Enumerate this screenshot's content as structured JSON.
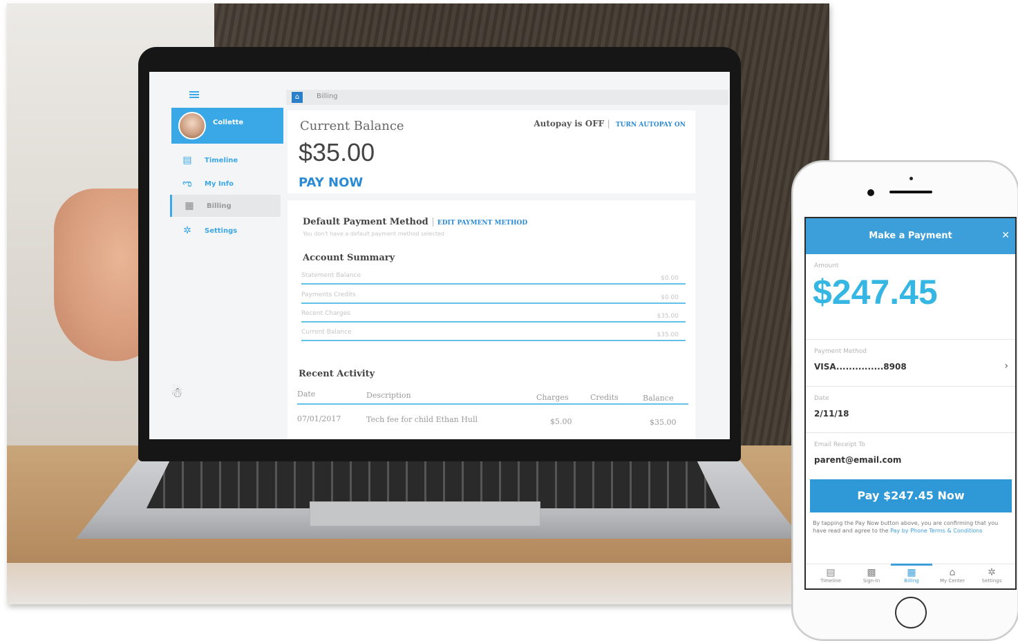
{
  "laptop": {
    "sidebar": {
      "user_name": "Collette",
      "items": [
        {
          "label": "Timeline",
          "icon": "timeline-icon"
        },
        {
          "label": "My Info",
          "icon": "my-info-icon"
        },
        {
          "label": "Billing",
          "icon": "billing-icon"
        },
        {
          "label": "Settings",
          "icon": "gear-icon"
        }
      ],
      "active_item": "Billing"
    },
    "breadcrumb": "Billing",
    "balance": {
      "label": "Current Balance",
      "amount": "$35.00",
      "pay_now": "PAY NOW",
      "autopay_status": "Autopay is OFF",
      "autopay_link": "TURN AUTOPAY ON"
    },
    "payment_method": {
      "title": "Default Payment Method",
      "edit_link": "EDIT PAYMENT METHOD",
      "note": "You don't have a default payment method selected"
    },
    "account_summary": {
      "title": "Account Summary",
      "rows": [
        {
          "label": "Statement Balance",
          "value": "$0.00"
        },
        {
          "label": "Payments Credits",
          "value": "$0.00"
        },
        {
          "label": "Recent Charges",
          "value": "$35.00"
        },
        {
          "label": "Current Balance",
          "value": "$35.00"
        }
      ]
    },
    "recent_activity": {
      "title": "Recent Activity",
      "columns": [
        "Date",
        "Description",
        "Charges",
        "Credits",
        "Balance"
      ],
      "rows": [
        {
          "date": "07/01/2017",
          "description": "Tech fee for child Ethan Hull",
          "charges": "$5.00",
          "credits": "",
          "balance": "$35.00"
        }
      ]
    }
  },
  "phone": {
    "title": "Make a Payment",
    "amount_label": "Amount",
    "amount": "$247.45",
    "payment_method_label": "Payment Method",
    "payment_method": "VISA...............8908",
    "date_label": "Date",
    "date": "2/11/18",
    "email_label": "Email Receipt To",
    "email": "parent@email.com",
    "pay_button": "Pay $247.45 Now",
    "terms_text": "By tapping the Pay Now button above, you are confirming that you have read and agree to the",
    "terms_link": "Pay by Phone Terms & Conditions",
    "tabs": [
      {
        "label": "Timeline",
        "icon": "timeline-icon"
      },
      {
        "label": "Sign-In",
        "icon": "qr-code-icon"
      },
      {
        "label": "Billing",
        "icon": "billing-icon"
      },
      {
        "label": "My Center",
        "icon": "building-icon"
      },
      {
        "label": "Settings",
        "icon": "gear-icon"
      }
    ],
    "active_tab": "Billing"
  },
  "colors": {
    "brand_blue": "#3aa8e6",
    "amount_cyan": "#36b6e2",
    "button_blue": "#2f98d7"
  }
}
